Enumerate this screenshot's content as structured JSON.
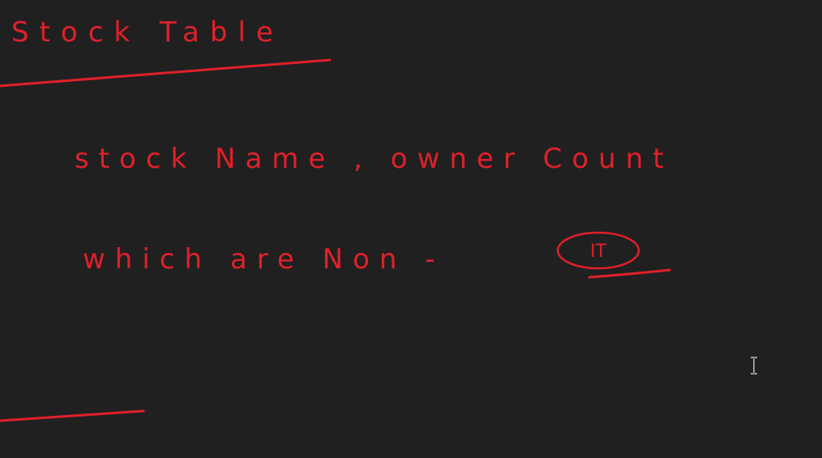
{
  "whiteboard": {
    "heading": "Stock Table",
    "line_2": "stock Name ,   owner Count",
    "line_3": "which  are    Non -",
    "circled_text": "IT"
  },
  "colors": {
    "background": "#202020",
    "ink": "#e0202a"
  },
  "icons": {
    "cursor": "text-cursor-icon"
  }
}
